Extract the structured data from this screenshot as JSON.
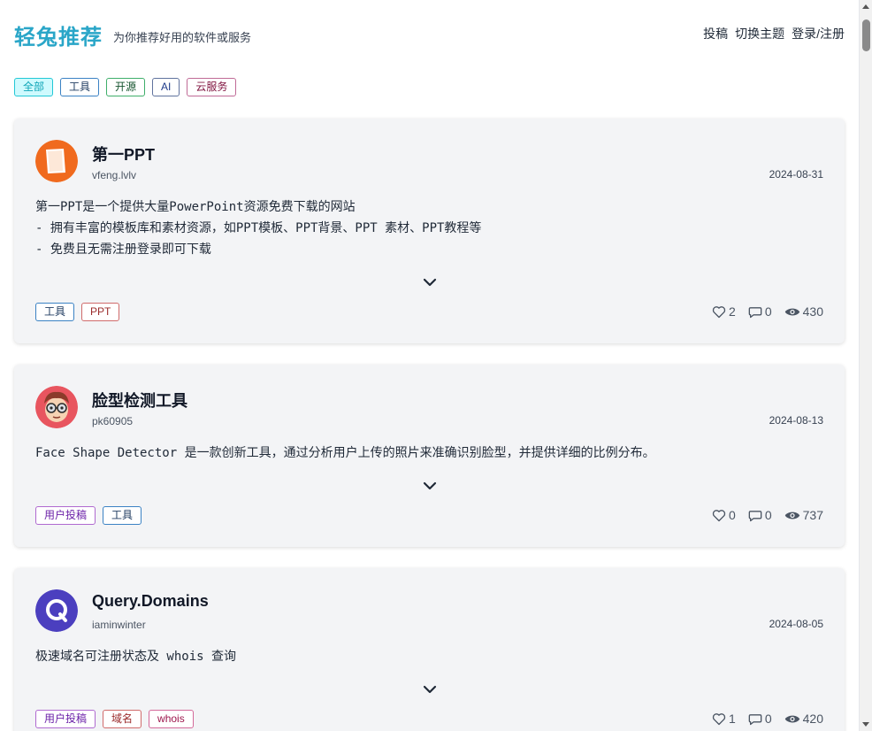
{
  "header": {
    "brand": "轻兔推荐",
    "slogan": "为你推荐好用的软件或服务",
    "nav": {
      "submit": "投稿",
      "theme": "切换主题",
      "login": "登录/注册"
    }
  },
  "filters": [
    "全部",
    "工具",
    "开源",
    "AI",
    "云服务"
  ],
  "cards": [
    {
      "title": "第一PPT",
      "author": "vfeng.lvlv",
      "date": "2024-08-31",
      "description": "第一PPT是一个提供大量PowerPoint资源免费下载的网站\n- 拥有丰富的模板库和素材资源，如PPT模板、PPT背景、PPT 素材、PPT教程等\n- 免费且无需注册登录即可下载",
      "tags": [
        "工具",
        "PPT"
      ],
      "likes": "2",
      "comments": "0",
      "views": "430",
      "avatar_icon": "ppt-logo-icon"
    },
    {
      "title": "脸型检测工具",
      "author": "pk60905",
      "date": "2024-08-13",
      "description": "Face Shape Detector 是一款创新工具，通过分析用户上传的照片来准确识别脸型，并提供详细的比例分布。",
      "tags": [
        "用户投稿",
        "工具"
      ],
      "likes": "0",
      "comments": "0",
      "views": "737",
      "avatar_icon": "face-glasses-icon"
    },
    {
      "title": "Query.Domains",
      "author": "iaminwinter",
      "date": "2024-08-05",
      "description": "极速域名可注册状态及 whois 查询",
      "tags": [
        "用户投稿",
        "域名",
        "whois"
      ],
      "likes": "1",
      "comments": "0",
      "views": "420",
      "avatar_icon": "q-logo-icon"
    }
  ],
  "colors": {
    "brand": "#2aa6c8",
    "card_bg": "#f3f4f6",
    "active_filter_bg": "#cffafe"
  }
}
